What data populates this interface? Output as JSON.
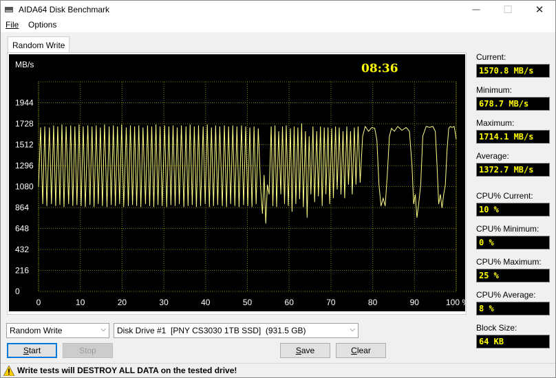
{
  "window": {
    "title": "AIDA64 Disk Benchmark",
    "icon": "disk-drive-icon"
  },
  "titlebar_buttons": {
    "minimize": "—",
    "maximize": "☐",
    "close": "✕"
  },
  "menu": {
    "file": "File",
    "options": "Options"
  },
  "tab": {
    "label": "Random Write"
  },
  "graph": {
    "timer": "08:36",
    "colors": {
      "background": "#000000",
      "grid": "#808000",
      "line": "#ffff88",
      "axis_text": "#ffffff",
      "timer": "#ffff00"
    }
  },
  "chart_data": {
    "type": "line",
    "ylabel": "MB/s",
    "yticks": [
      "1944",
      "1728",
      "1512",
      "1296",
      "1080",
      "864",
      "648",
      "432",
      "216",
      "0"
    ],
    "ylim": [
      0,
      2160
    ],
    "xticks": [
      "0",
      "10",
      "20",
      "30",
      "40",
      "50",
      "60",
      "70",
      "80",
      "90",
      "100 %"
    ],
    "xlim": [
      0,
      100
    ],
    "grid": true,
    "series": [
      {
        "values": [
          [
            0.0,
            1080
          ],
          [
            0.5,
            1690
          ],
          [
            1.0,
            900
          ],
          [
            1.5,
            1700
          ],
          [
            2.0,
            880
          ],
          [
            2.6,
            1690
          ],
          [
            3.1,
            900
          ],
          [
            3.6,
            1710
          ],
          [
            4.1,
            880
          ],
          [
            4.6,
            1700
          ],
          [
            5.1,
            890
          ],
          [
            5.6,
            1720
          ],
          [
            6.1,
            870
          ],
          [
            6.6,
            1700
          ],
          [
            7.2,
            900
          ],
          [
            7.7,
            1710
          ],
          [
            8.2,
            880
          ],
          [
            8.7,
            1700
          ],
          [
            9.2,
            890
          ],
          [
            9.7,
            1720
          ],
          [
            10.2,
            880
          ],
          [
            10.7,
            1700
          ],
          [
            11.2,
            870
          ],
          [
            11.8,
            1710
          ],
          [
            12.3,
            890
          ],
          [
            12.8,
            1700
          ],
          [
            13.3,
            870
          ],
          [
            13.8,
            1710
          ],
          [
            14.3,
            900
          ],
          [
            14.8,
            1690
          ],
          [
            15.3,
            880
          ],
          [
            15.8,
            1720
          ],
          [
            16.4,
            870
          ],
          [
            16.9,
            1700
          ],
          [
            17.4,
            890
          ],
          [
            17.9,
            1710
          ],
          [
            18.4,
            880
          ],
          [
            18.9,
            1700
          ],
          [
            19.4,
            900
          ],
          [
            19.9,
            1720
          ],
          [
            20.4,
            870
          ],
          [
            21.0,
            1690
          ],
          [
            21.5,
            880
          ],
          [
            22.0,
            1710
          ],
          [
            22.5,
            890
          ],
          [
            23.0,
            1700
          ],
          [
            23.5,
            880
          ],
          [
            24.0,
            1710
          ],
          [
            24.5,
            870
          ],
          [
            25.0,
            1690
          ],
          [
            25.6,
            900
          ],
          [
            26.1,
            1710
          ],
          [
            26.6,
            880
          ],
          [
            27.1,
            1700
          ],
          [
            27.6,
            870
          ],
          [
            28.1,
            1720
          ],
          [
            28.6,
            890
          ],
          [
            29.1,
            1700
          ],
          [
            29.6,
            880
          ],
          [
            30.2,
            1710
          ],
          [
            30.7,
            870
          ],
          [
            31.2,
            1700
          ],
          [
            31.7,
            890
          ],
          [
            32.2,
            1710
          ],
          [
            32.7,
            880
          ],
          [
            33.2,
            1690
          ],
          [
            33.7,
            900
          ],
          [
            34.2,
            1710
          ],
          [
            34.8,
            870
          ],
          [
            35.3,
            1700
          ],
          [
            35.8,
            880
          ],
          [
            36.3,
            1720
          ],
          [
            36.8,
            890
          ],
          [
            37.3,
            1700
          ],
          [
            37.8,
            870
          ],
          [
            38.3,
            1710
          ],
          [
            38.8,
            880
          ],
          [
            39.4,
            1700
          ],
          [
            39.9,
            900
          ],
          [
            40.4,
            1720
          ],
          [
            40.9,
            870
          ],
          [
            41.4,
            1690
          ],
          [
            41.9,
            880
          ],
          [
            42.4,
            1710
          ],
          [
            42.9,
            890
          ],
          [
            43.4,
            1700
          ],
          [
            44.0,
            880
          ],
          [
            44.5,
            1710
          ],
          [
            45.0,
            870
          ],
          [
            45.5,
            1700
          ],
          [
            46.0,
            900
          ],
          [
            46.5,
            1710
          ],
          [
            47.0,
            880
          ],
          [
            47.5,
            1700
          ],
          [
            48.0,
            870
          ],
          [
            48.6,
            1710
          ],
          [
            49.1,
            890
          ],
          [
            49.6,
            1700
          ],
          [
            50.1,
            880
          ],
          [
            50.6,
            1690
          ],
          [
            51.1,
            870
          ],
          [
            51.6,
            1700
          ],
          [
            52.1,
            900
          ],
          [
            52.6,
            1680
          ],
          [
            53.2,
            1050
          ],
          [
            53.6,
            800
          ],
          [
            54.0,
            1200
          ],
          [
            54.4,
            700
          ],
          [
            54.8,
            1100
          ],
          [
            55.2,
            1000
          ],
          [
            55.7,
            1700
          ],
          [
            56.1,
            880
          ],
          [
            56.6,
            1710
          ],
          [
            57.0,
            870
          ],
          [
            57.5,
            1650
          ],
          [
            58.0,
            1000
          ],
          [
            58.4,
            1700
          ],
          [
            58.9,
            900
          ],
          [
            59.3,
            1710
          ],
          [
            59.8,
            880
          ],
          [
            60.3,
            1680
          ],
          [
            60.7,
            820
          ],
          [
            61.2,
            1700
          ],
          [
            61.6,
            900
          ],
          [
            62.1,
            1690
          ],
          [
            62.5,
            950
          ],
          [
            63.0,
            1730
          ],
          [
            63.4,
            870
          ],
          [
            63.9,
            1650
          ],
          [
            64.3,
            760
          ],
          [
            64.8,
            1600
          ],
          [
            65.2,
            1000
          ],
          [
            65.7,
            1700
          ],
          [
            66.1,
            920
          ],
          [
            66.6,
            1650
          ],
          [
            67.0,
            980
          ],
          [
            67.5,
            1700
          ],
          [
            67.9,
            880
          ],
          [
            68.4,
            1690
          ],
          [
            68.8,
            1000
          ],
          [
            69.3,
            1690
          ],
          [
            69.7,
            900
          ],
          [
            70.2,
            1680
          ],
          [
            70.6,
            960
          ],
          [
            71.1,
            1700
          ],
          [
            71.5,
            1050
          ],
          [
            72.0,
            1690
          ],
          [
            72.4,
            1000
          ],
          [
            72.9,
            1650
          ],
          [
            73.3,
            960
          ],
          [
            73.8,
            1700
          ],
          [
            74.2,
            1100
          ],
          [
            74.7,
            1650
          ],
          [
            75.1,
            1000
          ],
          [
            75.6,
            1690
          ],
          [
            76.0,
            1100
          ],
          [
            76.5,
            1700
          ],
          [
            77.0,
            1120
          ],
          [
            77.6,
            1600
          ],
          [
            78.2,
            1700
          ],
          [
            79.0,
            1650
          ],
          [
            79.8,
            1690
          ],
          [
            80.5,
            1680
          ],
          [
            81.0,
            1560
          ],
          [
            81.5,
            1100
          ],
          [
            82.0,
            880
          ],
          [
            82.5,
            960
          ],
          [
            83.0,
            880
          ],
          [
            83.5,
            1200
          ],
          [
            84.0,
            1600
          ],
          [
            84.5,
            1680
          ],
          [
            85.2,
            1650
          ],
          [
            86.0,
            1700
          ],
          [
            87.0,
            1660
          ],
          [
            88.0,
            1690
          ],
          [
            88.8,
            1650
          ],
          [
            89.4,
            1300
          ],
          [
            89.8,
            900
          ],
          [
            90.2,
            1000
          ],
          [
            90.6,
            760
          ],
          [
            91.0,
            900
          ],
          [
            91.5,
            1100
          ],
          [
            92.0,
            1600
          ],
          [
            92.8,
            1700
          ],
          [
            93.6,
            1690
          ],
          [
            94.4,
            1700
          ],
          [
            95.0,
            1650
          ],
          [
            95.4,
            1300
          ],
          [
            95.8,
            900
          ],
          [
            96.2,
            1000
          ],
          [
            96.6,
            860
          ],
          [
            97.0,
            1000
          ],
          [
            97.4,
            1100
          ],
          [
            97.8,
            1450
          ],
          [
            98.2,
            1680
          ],
          [
            98.6,
            1700
          ],
          [
            99.0,
            1690
          ],
          [
            99.5,
            1700
          ],
          [
            100.0,
            1570
          ]
        ]
      }
    ]
  },
  "stats": {
    "current_label": "Current:",
    "current_value": "1570.8 MB/s",
    "minimum_label": "Minimum:",
    "minimum_value": "678.7 MB/s",
    "maximum_label": "Maximum:",
    "maximum_value": "1714.1 MB/s",
    "average_label": "Average:",
    "average_value": "1372.7 MB/s",
    "cpu_current_label": "CPU% Current:",
    "cpu_current_value": "10 %",
    "cpu_minimum_label": "CPU% Minimum:",
    "cpu_minimum_value": "0 %",
    "cpu_maximum_label": "CPU% Maximum:",
    "cpu_maximum_value": "25 %",
    "cpu_average_label": "CPU% Average:",
    "cpu_average_value": "8 %",
    "block_size_label": "Block Size:",
    "block_size_value": "64 KB"
  },
  "controls": {
    "test_select": "Random Write",
    "drive_select": "Disk Drive #1  [PNY CS3030 1TB SSD]  (931.5 GB)",
    "start_mnemonic": "S",
    "start_rest": "tart",
    "stop": "Stop",
    "save_mnemonic": "S",
    "save_rest": "ave",
    "clear_mnemonic": "C",
    "clear_rest": "lear"
  },
  "status": {
    "warning": "Write tests will DESTROY ALL DATA on the tested drive!",
    "icon": "warning-icon"
  }
}
